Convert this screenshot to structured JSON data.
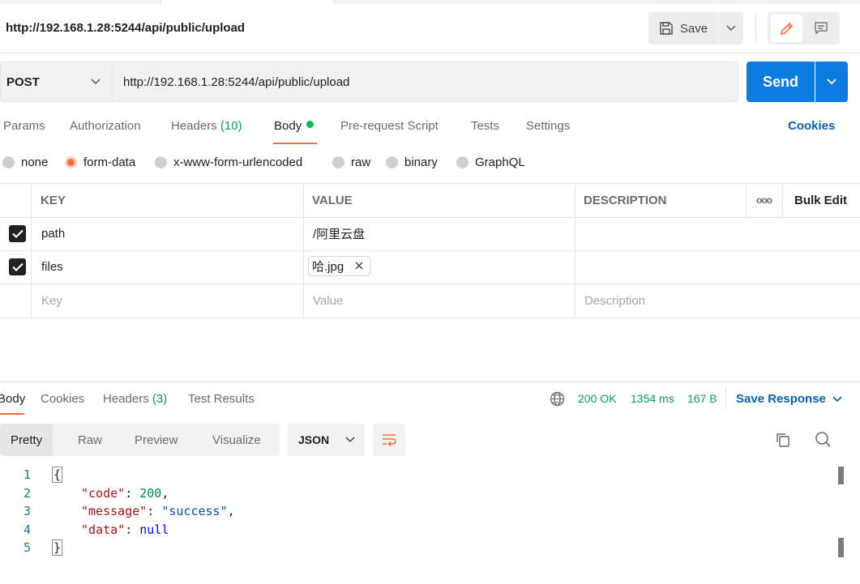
{
  "header": {
    "title": "http://192.168.1.28:5244/api/public/upload",
    "save_label": "Save"
  },
  "request": {
    "method": "POST",
    "url": "http://192.168.1.28:5244/api/public/upload",
    "send_label": "Send",
    "tabs": [
      {
        "label": "Params"
      },
      {
        "label": "Authorization"
      },
      {
        "label": "Headers",
        "count": "(10)"
      },
      {
        "label": "Body"
      },
      {
        "label": "Pre-request Script"
      },
      {
        "label": "Tests"
      },
      {
        "label": "Settings"
      }
    ],
    "cookies_label": "Cookies",
    "body_types": [
      "none",
      "form-data",
      "x-www-form-urlencoded",
      "raw",
      "binary",
      "GraphQL"
    ],
    "selected_body_type": "form-data"
  },
  "form_table": {
    "headers": {
      "key": "KEY",
      "value": "VALUE",
      "description": "DESCRIPTION",
      "more": "ooo",
      "bulk_edit": "Bulk Edit"
    },
    "rows": [
      {
        "checked": true,
        "key": "path",
        "value": "/阿里云盘",
        "description": ""
      },
      {
        "checked": true,
        "key": "files",
        "value": "哈.jpg",
        "description": ""
      }
    ],
    "placeholders": {
      "key": "Key",
      "value": "Value",
      "description": "Description"
    }
  },
  "response": {
    "tabs": [
      {
        "label": "Body"
      },
      {
        "label": "Cookies"
      },
      {
        "label": "Headers",
        "count": "(3)"
      },
      {
        "label": "Test Results"
      }
    ],
    "status": "200 OK",
    "time": "1354 ms",
    "size": "167 B",
    "save_response_label": "Save Response",
    "views": [
      "Pretty",
      "Raw",
      "Preview",
      "Visualize"
    ],
    "format": "JSON",
    "line_numbers": [
      "1",
      "2",
      "3",
      "4",
      "5"
    ],
    "json": {
      "open": "{",
      "close": "}",
      "code_key": "\"code\"",
      "code_value": "200",
      "message_key": "\"message\"",
      "message_value": "\"success\"",
      "data_key": "\"data\"",
      "data_value": "null"
    }
  },
  "colors": {
    "accent": "#ff6c37",
    "primary": "#0b7bdf",
    "success": "#0c9b52",
    "link": "#0b5fae"
  }
}
